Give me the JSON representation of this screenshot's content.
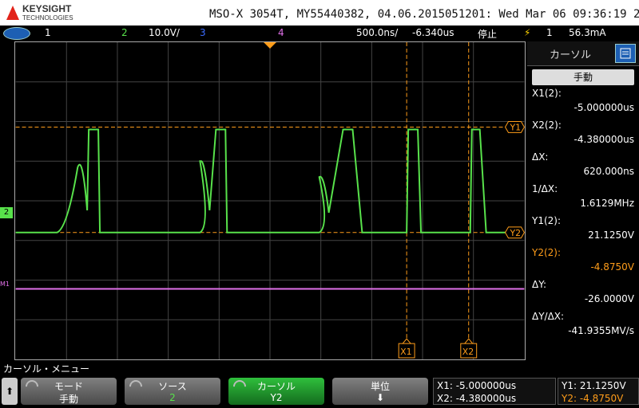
{
  "header": {
    "brand": "KEYSIGHT",
    "brand_sub": "TECHNOLOGIES",
    "title": "MSO-X 3054T, MY55440382, 04.06.2015051201: Wed Mar 06 09:36:19 2019"
  },
  "statusbar": {
    "ch1": "1",
    "ch2": "2",
    "ch2_scale": "10.0V/",
    "ch3": "3",
    "ch4": "4",
    "timebase": "500.0ns/",
    "delay": "-6.340us",
    "run_state": "停止",
    "trigger_src": "1",
    "trigger_level": "56.3mA"
  },
  "grid_labels": {
    "ch2_marker": "2",
    "digital_marker": "M1",
    "y1": "Y1",
    "y2": "Y2",
    "x1": "X1",
    "x2": "X2"
  },
  "panel": {
    "tab_label": "カーソル",
    "mode_button": "手動",
    "x1_label": "X1(2):",
    "x1_value": "-5.000000us",
    "x2_label": "X2(2):",
    "x2_value": "-4.380000us",
    "dx_label": "ΔX:",
    "dx_value": "620.000ns",
    "inv_dx_label": "1/ΔX:",
    "inv_dx_value": "1.6129MHz",
    "y1_label": "Y1(2):",
    "y1_value": "21.1250V",
    "y2_label": "Y2(2):",
    "y2_value": "-4.8750V",
    "dy_label": "ΔY:",
    "dy_value": "-26.0000V",
    "dydx_label": "ΔY/ΔX:",
    "dydx_value": "-41.9355MV/s"
  },
  "bottom": {
    "menu_title": "カーソル・メニュー",
    "back_label": "⬆",
    "mode_key": "モード",
    "mode_val": "手動",
    "source_key": "ソース",
    "source_val": "2",
    "cursor_key": "カーソル",
    "cursor_val": "Y2",
    "units_key": "単位",
    "units_val": "⬇",
    "info_x1": "X1: -5.000000us",
    "info_x2": "X2: -4.380000us",
    "info_y1": "Y1: 21.1250V",
    "info_y2": "Y2: -4.8750V"
  },
  "colors": {
    "ch2": "#58e24b",
    "ch4": "#e070e8",
    "cursor": "#ff9d1a",
    "ch3": "#3b6bff",
    "header_bg": "#ffffff",
    "selected_key": "#1e8a2a"
  }
}
